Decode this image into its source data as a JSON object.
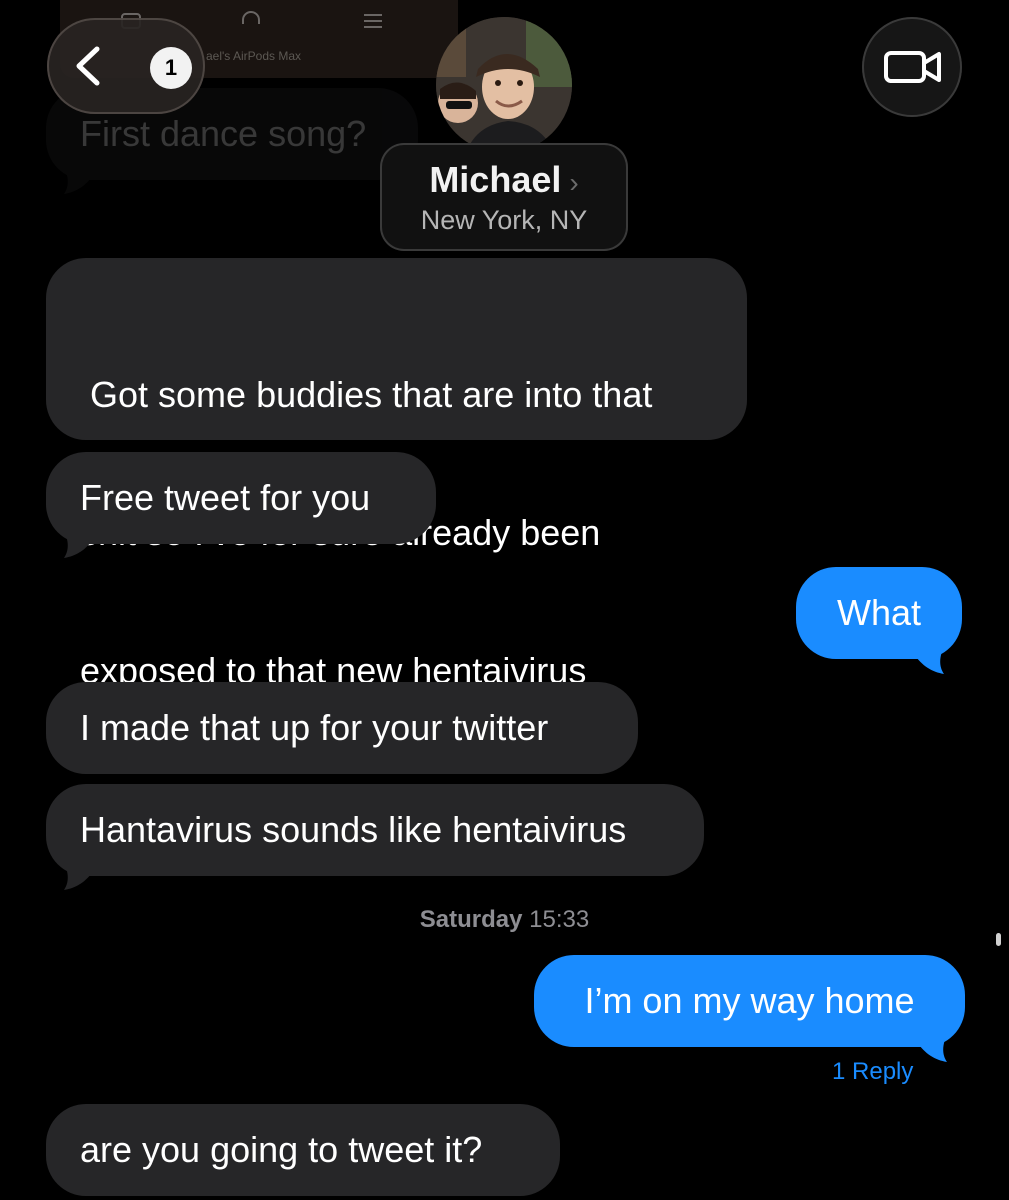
{
  "media_banner": {
    "text": "ael's AirPods Max"
  },
  "header": {
    "back_badge": "1",
    "contact_name": "Michael",
    "contact_chevron": "›",
    "contact_location": "New York, NY"
  },
  "messages": [
    {
      "direction": "incoming",
      "text": "First dance song?",
      "faded": true
    },
    {
      "direction": "incoming",
      "lines": [
        " Got some buddies that are into that",
        "shit so I’ve for sure already been",
        "exposed to that new hentaivirus"
      ]
    },
    {
      "direction": "incoming",
      "text": "Free tweet for you"
    },
    {
      "direction": "outgoing",
      "text": "What"
    },
    {
      "direction": "incoming",
      "text": "I made that up for your twitter"
    },
    {
      "direction": "incoming",
      "text": "Hantavirus sounds like hentaivirus"
    },
    {
      "direction": "outgoing",
      "text": "I’m on my way home",
      "reply_label": "1 Reply"
    },
    {
      "direction": "incoming",
      "text": "are you going to tweet it?"
    }
  ],
  "timestamp": {
    "day": "Saturday",
    "time": "15:33"
  },
  "icons": {
    "back": "chevron-left-icon",
    "video": "video-camera-icon",
    "contact_chevron": "chevron-right-icon"
  },
  "colors": {
    "background": "#000000",
    "incoming_bubble": "#262628",
    "outgoing_bubble": "#1a8cff",
    "reply_link": "#1a8cff",
    "timestamp": "#8e8e93"
  }
}
